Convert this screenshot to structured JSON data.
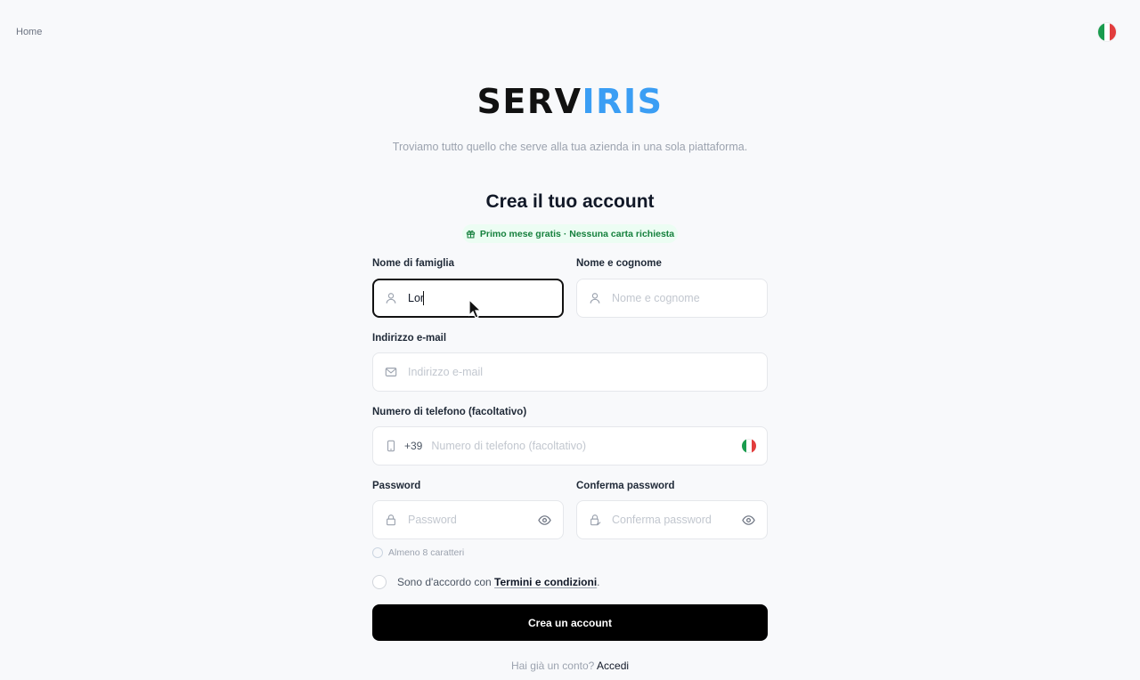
{
  "nav": {
    "home_label": "Home"
  },
  "language": {
    "code": "it",
    "colors": [
      "#1a9c4e",
      "#ffffff",
      "#e23d3d"
    ]
  },
  "brand": {
    "part1": "SERV",
    "part2": "IRIS",
    "part1_color": "#111111",
    "part2_color": "#3b9ef4"
  },
  "tagline": "Troviamo tutto quello che serve alla tua azienda in una sola piattaforma.",
  "form": {
    "title": "Crea il tuo account",
    "promo": "Primo mese gratis · Nessuna carta richiesta",
    "family_name": {
      "label": "Nome di famiglia",
      "value": "Lor",
      "placeholder": "",
      "icon": "user-icon"
    },
    "full_name": {
      "label": "Nome e cognome",
      "value": "",
      "placeholder": "Nome e cognome",
      "icon": "user-icon"
    },
    "email": {
      "label": "Indirizzo e-mail",
      "value": "",
      "placeholder": "Indirizzo e-mail",
      "icon": "mail-icon"
    },
    "phone": {
      "label": "Numero di telefono (facoltativo)",
      "prefix": "+39",
      "value": "",
      "placeholder": "Numero di telefono (facoltativo)",
      "icon": "phone-icon"
    },
    "password": {
      "label": "Password",
      "value": "",
      "placeholder": "Password",
      "icon": "lock-icon"
    },
    "confirm_password": {
      "label": "Conferma password",
      "value": "",
      "placeholder": "Conferma password",
      "icon": "lock-check-icon"
    },
    "password_hint": "Almeno 8 caratteri",
    "terms": {
      "prefix": "Sono d'accordo con",
      "link": "Termini e condizioni",
      "suffix": "."
    },
    "submit_label": "Crea un account",
    "login_prompt": "Hai già un conto?",
    "login_link": "Accedi"
  },
  "colors": {
    "accent": "#3b9ef4",
    "button_bg": "#000000",
    "promo_bg": "#ecfdf3",
    "promo_text": "#15803d"
  }
}
